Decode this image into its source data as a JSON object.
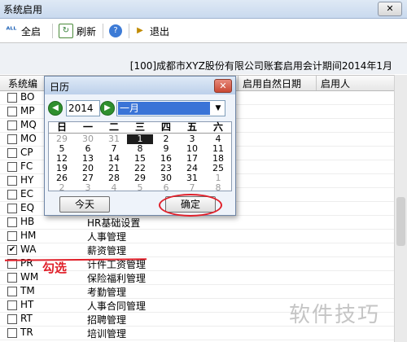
{
  "window": {
    "title": "系统启用",
    "close_label": "✕"
  },
  "toolbar": {
    "enable_all_label": "全启",
    "refresh_label": "刷新",
    "exit_label": "退出"
  },
  "info_line": "[100]成都市XYZ股份有限公司账套启用会计期间2014年1月",
  "table": {
    "headers": [
      "系统编",
      "启用自然日期",
      "启用人"
    ],
    "rows": [
      {
        "code": "BO",
        "name": "",
        "checked": false
      },
      {
        "code": "MP",
        "name": "",
        "checked": false
      },
      {
        "code": "MQ",
        "name": "",
        "checked": false
      },
      {
        "code": "MO",
        "name": "",
        "checked": false
      },
      {
        "code": "CP",
        "name": "",
        "checked": false
      },
      {
        "code": "FC",
        "name": "",
        "checked": false
      },
      {
        "code": "HY",
        "name": "",
        "checked": false
      },
      {
        "code": "EC",
        "name": "",
        "checked": false
      },
      {
        "code": "EQ",
        "name": "",
        "checked": false
      },
      {
        "code": "HB",
        "name": "HR基础设置",
        "checked": false
      },
      {
        "code": "HM",
        "name": "人事管理",
        "checked": false
      },
      {
        "code": "WA",
        "name": "薪资管理",
        "checked": true
      },
      {
        "code": "PR",
        "name": "计件工资管理",
        "checked": false
      },
      {
        "code": "WM",
        "name": "保险福利管理",
        "checked": false
      },
      {
        "code": "TM",
        "name": "考勤管理",
        "checked": false
      },
      {
        "code": "HT",
        "name": "人事合同管理",
        "checked": false
      },
      {
        "code": "RT",
        "name": "招聘管理",
        "checked": false
      },
      {
        "code": "TR",
        "name": "培训管理",
        "checked": false
      }
    ]
  },
  "annotation": "勾选",
  "watermark": "软件技巧",
  "dialog": {
    "title": "日历",
    "year": "2014",
    "month": "一月",
    "weekdays": [
      "日",
      "一",
      "二",
      "三",
      "四",
      "五",
      "六"
    ],
    "weeks": [
      [
        {
          "d": "29",
          "g": true
        },
        {
          "d": "30",
          "g": true
        },
        {
          "d": "31",
          "g": true
        },
        {
          "d": "1",
          "s": true
        },
        {
          "d": "2"
        },
        {
          "d": "3"
        },
        {
          "d": "4"
        }
      ],
      [
        {
          "d": "5"
        },
        {
          "d": "6"
        },
        {
          "d": "7"
        },
        {
          "d": "8"
        },
        {
          "d": "9"
        },
        {
          "d": "10"
        },
        {
          "d": "11"
        }
      ],
      [
        {
          "d": "12"
        },
        {
          "d": "13"
        },
        {
          "d": "14"
        },
        {
          "d": "15"
        },
        {
          "d": "16"
        },
        {
          "d": "17"
        },
        {
          "d": "18"
        }
      ],
      [
        {
          "d": "19"
        },
        {
          "d": "20"
        },
        {
          "d": "21"
        },
        {
          "d": "22"
        },
        {
          "d": "23"
        },
        {
          "d": "24"
        },
        {
          "d": "25"
        }
      ],
      [
        {
          "d": "26"
        },
        {
          "d": "27"
        },
        {
          "d": "28"
        },
        {
          "d": "29"
        },
        {
          "d": "30"
        },
        {
          "d": "31"
        },
        {
          "d": "1",
          "g": true
        }
      ],
      [
        {
          "d": "2",
          "g": true
        },
        {
          "d": "3",
          "g": true
        },
        {
          "d": "4",
          "g": true
        },
        {
          "d": "5",
          "g": true
        },
        {
          "d": "6",
          "g": true
        },
        {
          "d": "7",
          "g": true
        },
        {
          "d": "8",
          "g": true
        }
      ]
    ],
    "today_label": "今天",
    "ok_label": "确定"
  },
  "colors": {
    "annotation_red": "#e0202a",
    "selection_blue": "#3a74d7",
    "nav_green": "#2e8f2e"
  }
}
